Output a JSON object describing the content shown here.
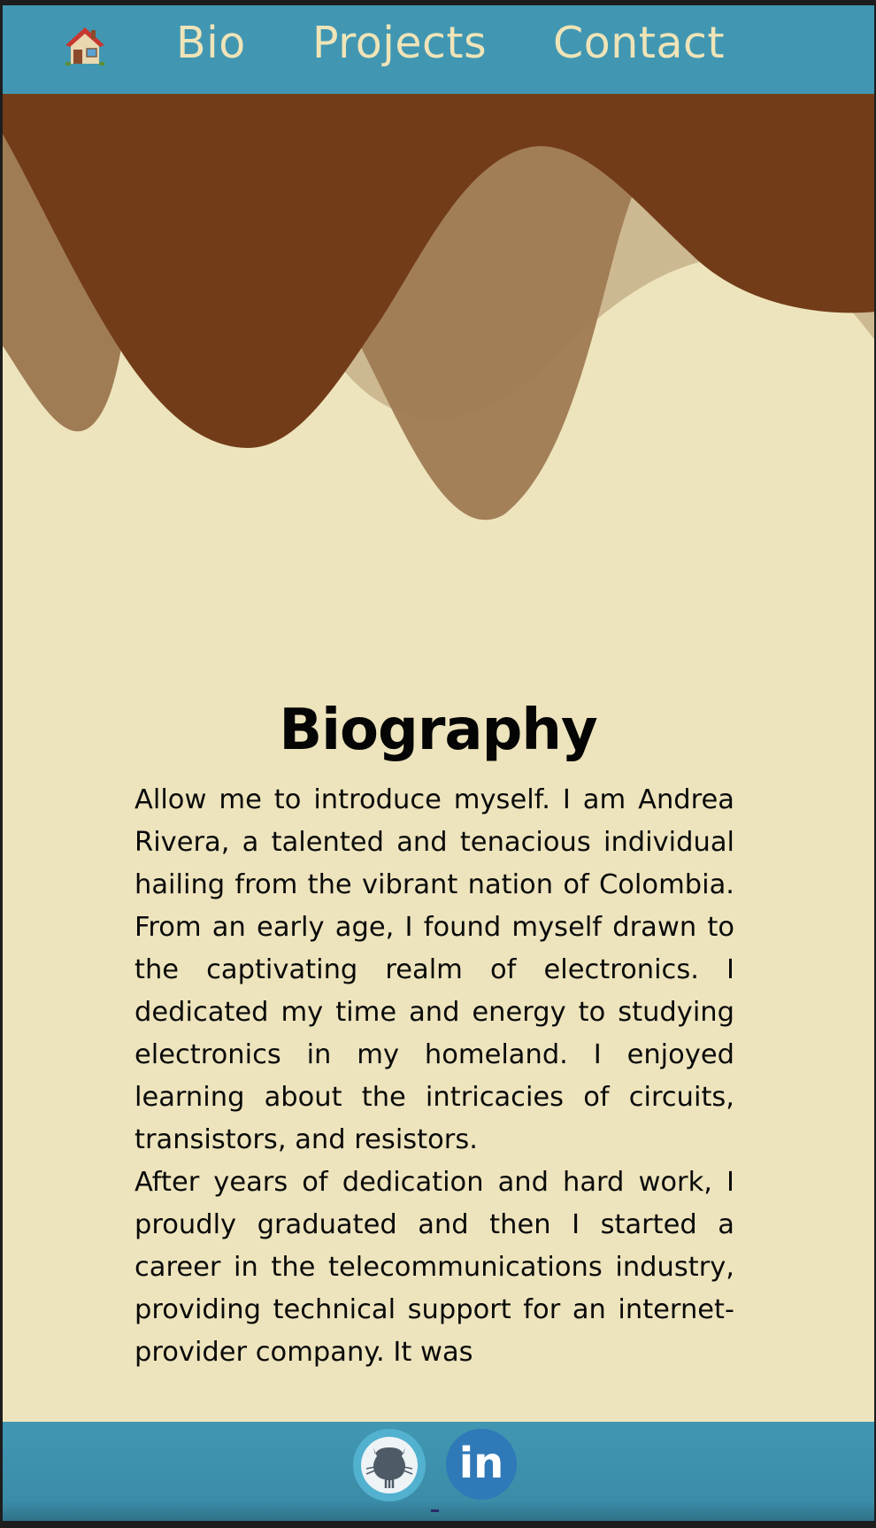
{
  "nav": {
    "home_icon": "house-icon",
    "links": [
      "Bio",
      "Projects",
      "Contact"
    ]
  },
  "colors": {
    "nav_bg": "#4197b2",
    "nav_text": "#efe4b8",
    "page_bg": "#ede4bd",
    "wave_dark": "#733c19",
    "wave_mid": "#a07c55",
    "wave_light": "#cdb991"
  },
  "content": {
    "title": "Biography",
    "paragraphs": [
      "Allow me to introduce myself. I am Andrea Rivera, a talented and tenacious individual hailing from the vibrant nation of Colombia. From an early age, I found myself drawn to the captivating realm of electronics. I dedicated my time and energy to studying electronics in my homeland. I enjoyed learning about the intricacies of circuits, transistors, and resistors.",
      "After years of dedication and hard work, I proudly graduated and then I started a career in the telecommunications industry, providing technical support for an internet-provider company. It was"
    ]
  },
  "footer": {
    "github_icon": "github-icon",
    "linkedin_icon": "linkedin-icon",
    "linkedin_label": "in"
  }
}
